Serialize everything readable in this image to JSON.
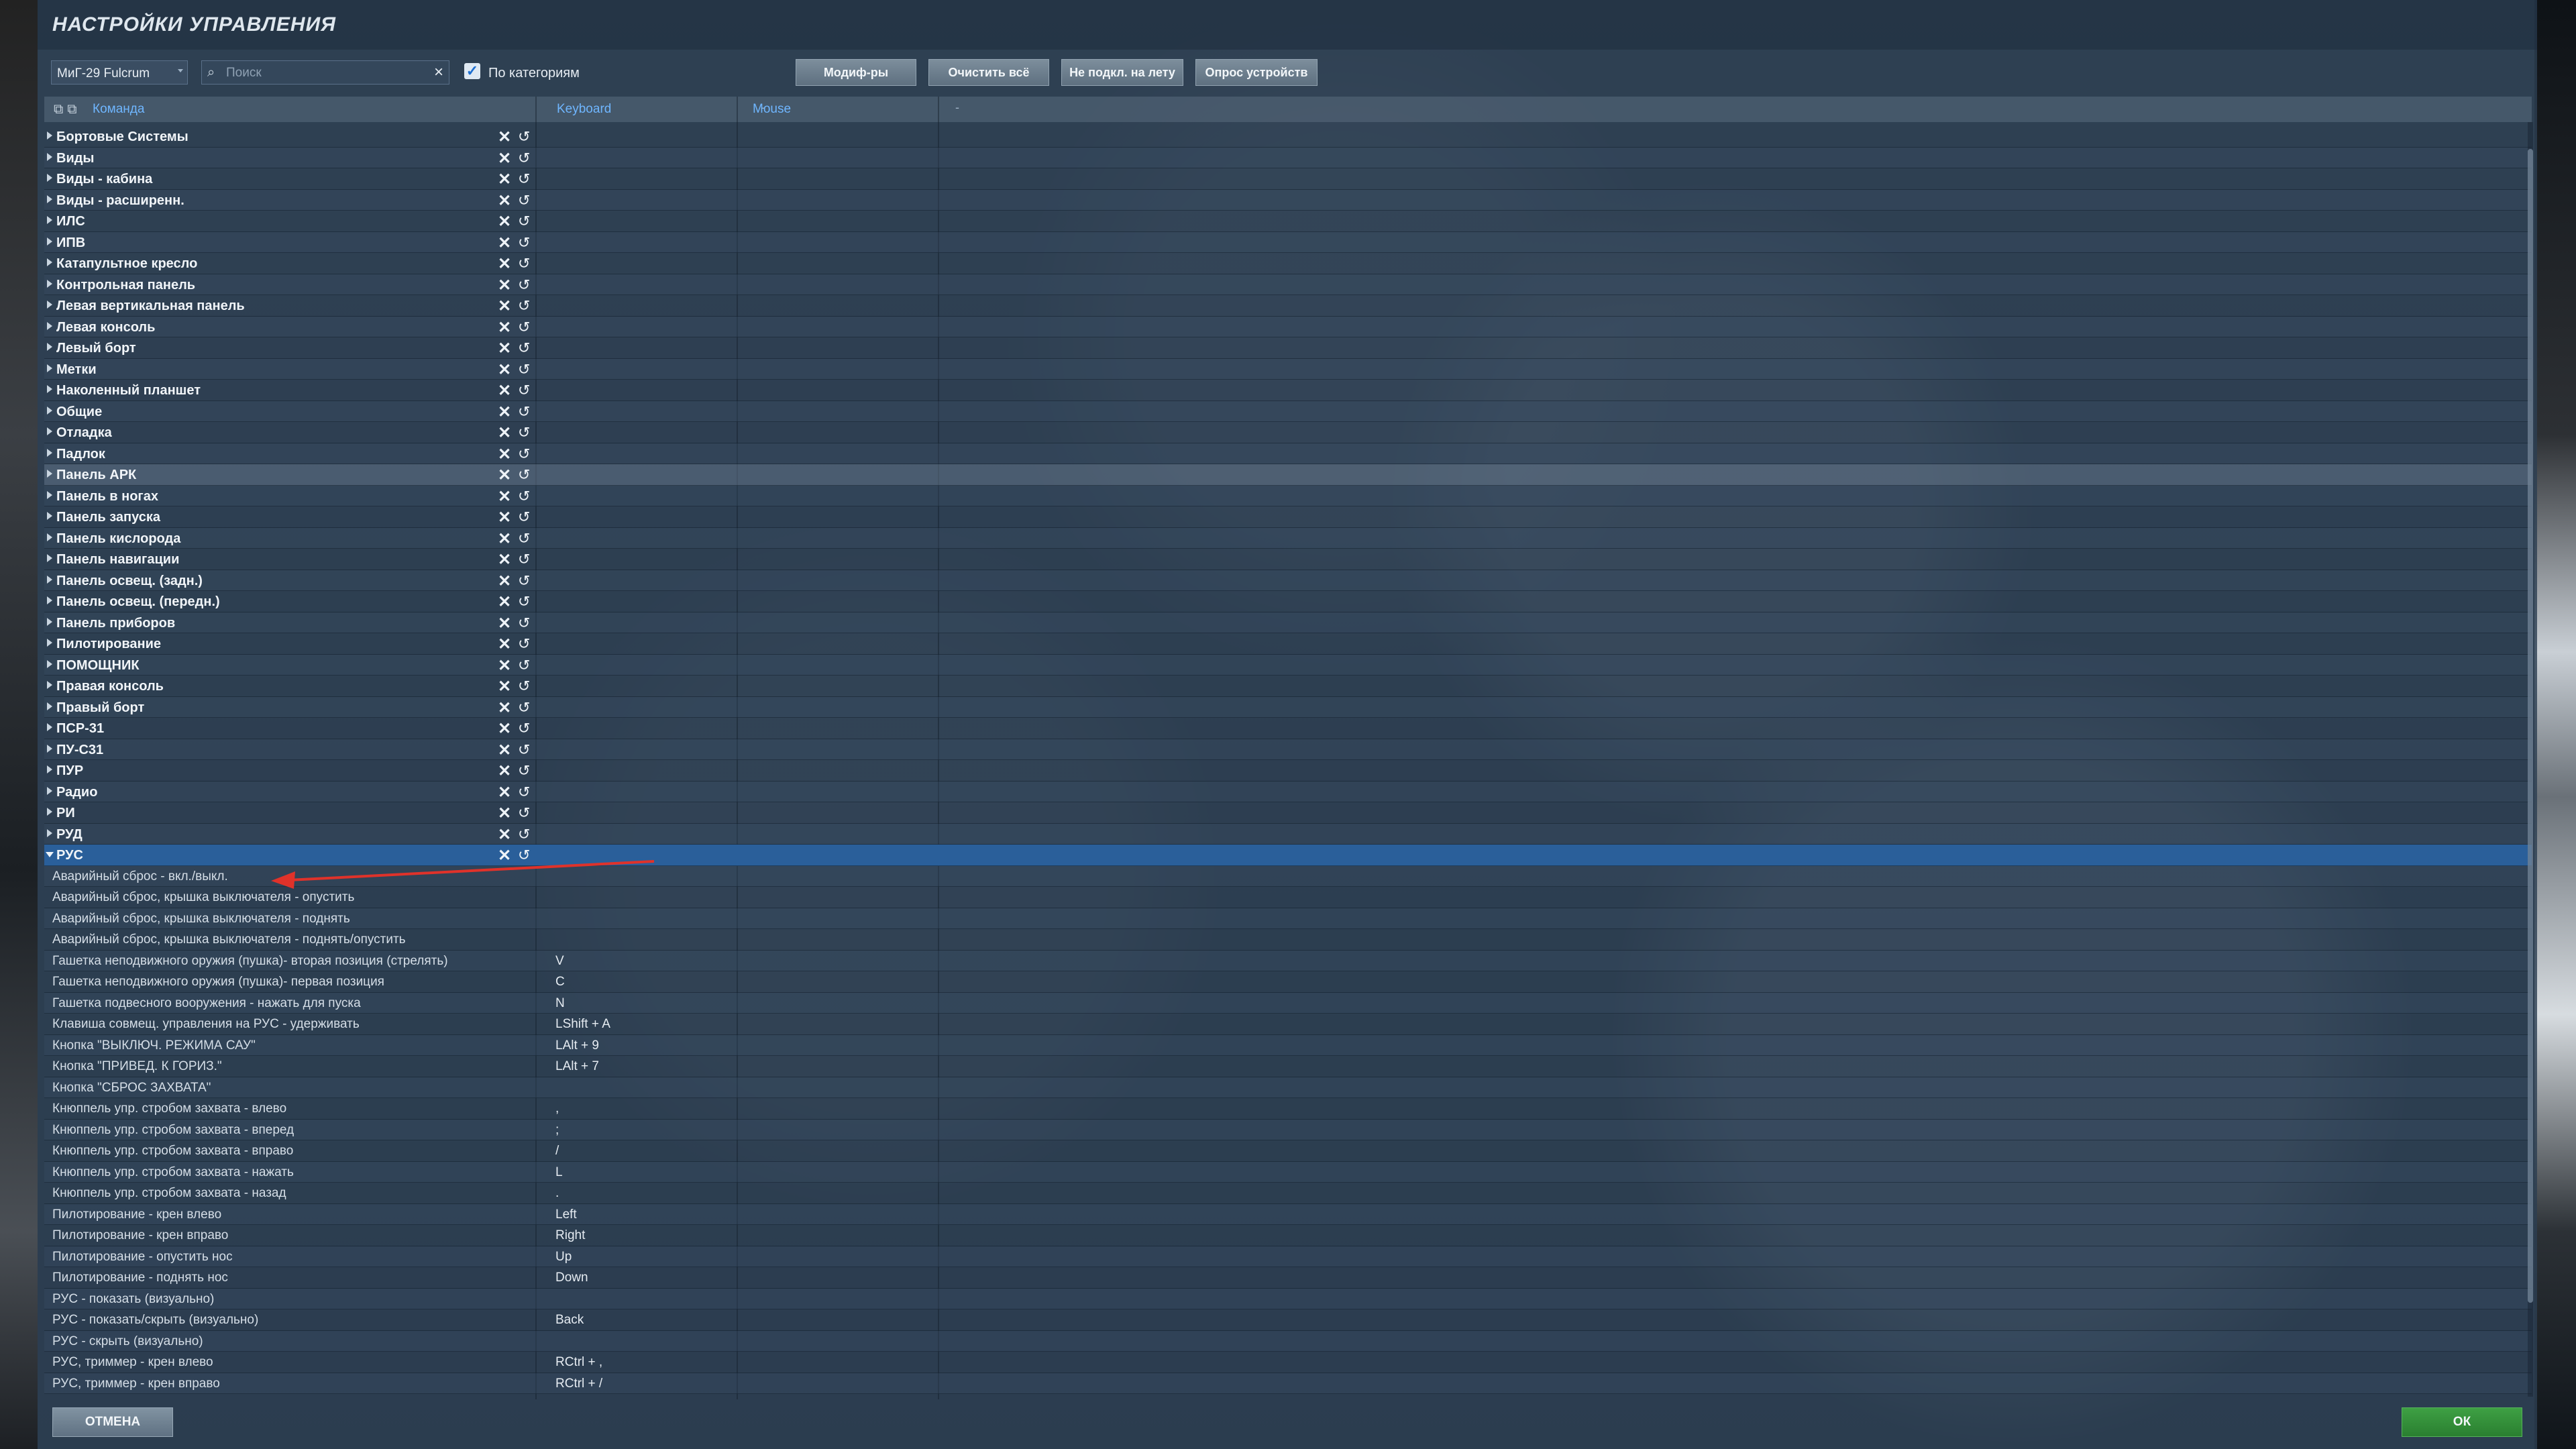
{
  "window": {
    "title": "НАСТРОЙКИ УПРАВЛЕНИЯ"
  },
  "toolbar": {
    "aircraft": "МиГ-29 Fulcrum",
    "search_placeholder": "Поиск",
    "by_category_label": "По категориям",
    "by_category_checked": true,
    "modifiers_label": "Модиф-ры",
    "clear_all_label": "Очистить всё",
    "not_connected_label": "Не подкл. на лету",
    "poll_devices_label": "Опрос устройств"
  },
  "columns": {
    "command": "Команда",
    "keyboard": "Keyboard",
    "mouse": "Mouse",
    "dash": "-"
  },
  "icons": {
    "delete": "✕",
    "reset": "↺",
    "expand": "triangle-right-icon",
    "collapse": "triangle-down-icon"
  },
  "categories": [
    "Бортовые Системы",
    "Виды",
    "Виды - кабина",
    "Виды - расширенн.",
    "ИЛС",
    "ИПВ",
    "Катапультное кресло",
    "Контрольная панель",
    "Левая вертикальная панель",
    "Левая консоль",
    "Левый борт",
    "Метки",
    "Наколенный планшет",
    "Общие",
    "Отладка",
    "Падлок",
    "Панель АРК",
    "Панель в ногах",
    "Панель запуска",
    "Панель кислорода",
    "Панель навигации",
    "Панель освещ. (задн.)",
    "Панель освещ. (передн.)",
    "Панель приборов",
    "Пилотирование",
    "ПОМОЩНИК",
    "Правая консоль",
    "Правый борт",
    "ПСР-31",
    "ПУ-С31",
    "ПУР",
    "Радио",
    "РИ",
    "РУД",
    "РУС"
  ],
  "commands": [
    {
      "name": "Аварийный сброс - вкл./выкл.",
      "keyboard": ""
    },
    {
      "name": "Аварийный сброс, крышка выключателя - опустить",
      "keyboard": ""
    },
    {
      "name": "Аварийный сброс, крышка выключателя - поднять",
      "keyboard": ""
    },
    {
      "name": "Аварийный сброс, крышка выключателя - поднять/опустить",
      "keyboard": ""
    },
    {
      "name": "Гашетка неподвижного оружия (пушка)- вторая позиция (стрелять)",
      "keyboard": "V"
    },
    {
      "name": "Гашетка неподвижного оружия (пушка)- первая позиция",
      "keyboard": "C"
    },
    {
      "name": "Гашетка подвесного вооружения - нажать для пуска",
      "keyboard": "N"
    },
    {
      "name": "Клавиша совмещ. управления на РУС - удерживать",
      "keyboard": "LShift + A"
    },
    {
      "name": "Кнопка \"ВЫКЛЮЧ. РЕЖИМА САУ\"",
      "keyboard": "LAlt + 9"
    },
    {
      "name": "Кнопка \"ПРИВЕД. К ГОРИЗ.\"",
      "keyboard": "LAlt + 7"
    },
    {
      "name": "Кнопка \"СБРОС ЗАХВАТА\"",
      "keyboard": ""
    },
    {
      "name": "Кнюппель упр. стробом захвата - влево",
      "keyboard": ","
    },
    {
      "name": "Кнюппель упр. стробом захвата - вперед",
      "keyboard": ";"
    },
    {
      "name": "Кнюппель упр. стробом захвата - вправо",
      "keyboard": "/"
    },
    {
      "name": "Кнюппель упр. стробом захвата - нажать",
      "keyboard": "L"
    },
    {
      "name": "Кнюппель упр. стробом захвата - назад",
      "keyboard": "."
    },
    {
      "name": "Пилотирование - крен влево",
      "keyboard": "Left"
    },
    {
      "name": "Пилотирование - крен вправо",
      "keyboard": "Right"
    },
    {
      "name": "Пилотирование - опустить нос",
      "keyboard": "Up"
    },
    {
      "name": "Пилотирование - поднять нос",
      "keyboard": "Down"
    },
    {
      "name": "РУС - показать (визуально)",
      "keyboard": ""
    },
    {
      "name": "РУС - показать/скрыть (визуально)",
      "keyboard": "Back"
    },
    {
      "name": "РУС - скрыть (визуально)",
      "keyboard": ""
    },
    {
      "name": "РУС, триммер - крен влево",
      "keyboard": "RCtrl + ,"
    },
    {
      "name": "РУС, триммер - крен вправо",
      "keyboard": "RCtrl + /"
    }
  ],
  "footer": {
    "cancel_label": "ОТМЕНА",
    "ok_label": "ОК"
  },
  "colors": {
    "accent": "#2a5f9a",
    "ok": "#34933a",
    "header_text": "#6fb6ff",
    "annotation_arrow": "#e0322a"
  }
}
